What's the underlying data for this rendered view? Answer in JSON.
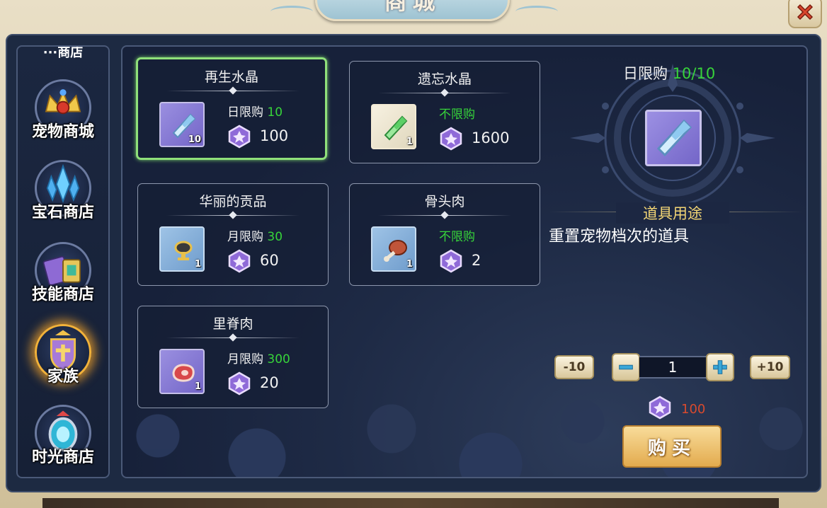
{
  "window": {
    "title": "商城",
    "close_icon": "close-x-icon"
  },
  "sidebar": {
    "cut_label": "···商店",
    "items": [
      {
        "label": "宠物商城",
        "icon": "pet-crown-icon",
        "active": false
      },
      {
        "label": "宝石商店",
        "icon": "crystal-cluster-icon",
        "active": false
      },
      {
        "label": "技能商店",
        "icon": "skill-book-icon",
        "active": false
      },
      {
        "label": "家族",
        "icon": "family-crest-icon",
        "active": true
      },
      {
        "label": "时光商店",
        "icon": "time-portal-icon",
        "active": false
      }
    ]
  },
  "shop_items": [
    {
      "name": "再生水晶",
      "limit_label": "日限购",
      "limit_value": "10",
      "count": "10",
      "price": "100",
      "icon": "blue-crystal-icon",
      "selected": true
    },
    {
      "name": "遗忘水晶",
      "limit_label": "不限购",
      "limit_value": "",
      "count": "1",
      "price": "1600",
      "icon": "green-crystal-icon",
      "selected": false
    },
    {
      "name": "华丽的贡品",
      "limit_label": "月限购",
      "limit_value": "30",
      "count": "1",
      "price": "60",
      "icon": "tribute-cup-icon",
      "selected": false
    },
    {
      "name": "骨头肉",
      "limit_label": "不限购",
      "limit_value": "",
      "count": "1",
      "price": "2",
      "icon": "bone-meat-icon",
      "selected": false
    },
    {
      "name": "里脊肉",
      "limit_label": "月限购",
      "limit_value": "300",
      "count": "1",
      "price": "20",
      "icon": "steak-icon",
      "selected": false
    }
  ],
  "detail": {
    "limit_label": "日限购",
    "limit_value": "10/10",
    "usage_title": "道具用途",
    "usage_desc": "重置宠物档次的道具",
    "minus10_label": "-10",
    "plus10_label": "+10",
    "quantity": "1",
    "total_price": "100",
    "buy_label": "购买"
  },
  "colors": {
    "green": "#37d43a",
    "gold_text": "#f3d675",
    "price_red": "#d94a2e",
    "gem": "#8f6ad8"
  }
}
